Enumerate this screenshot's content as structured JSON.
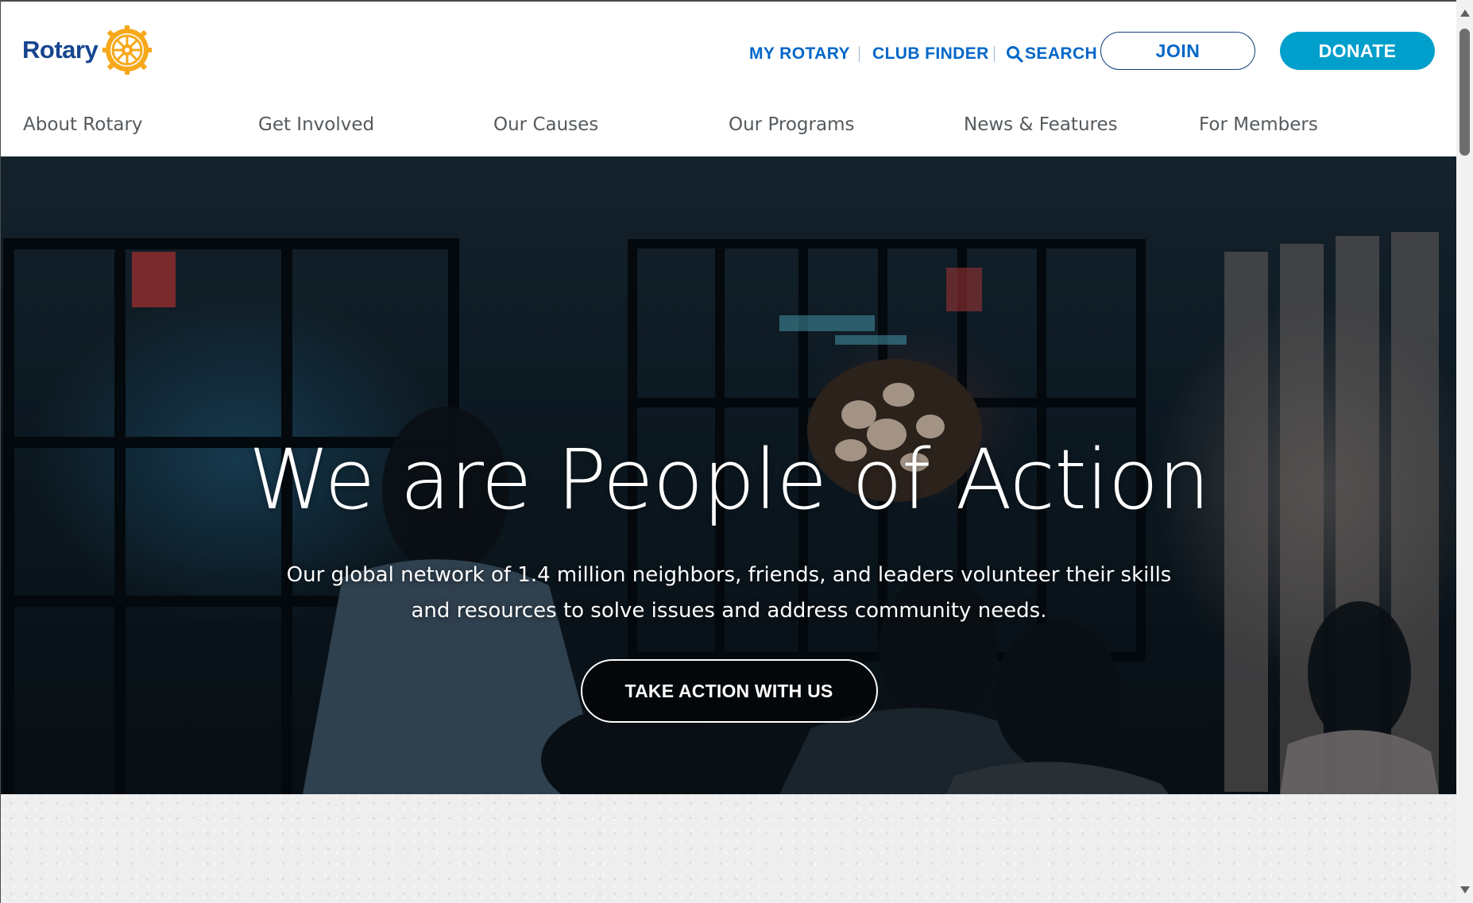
{
  "brand": {
    "name": "Rotary",
    "colors": {
      "navy": "#17458f",
      "link": "#0067c8",
      "donate": "#019fcb",
      "gold": "#f7a81b"
    },
    "logo_icon": "rotary-wheel-icon"
  },
  "utility_nav": {
    "my_rotary": "MY ROTARY",
    "club_finder": "CLUB FINDER",
    "search": "SEARCH",
    "search_icon": "search-icon",
    "join": "JOIN",
    "donate": "DONATE"
  },
  "main_nav": {
    "items": [
      {
        "label": "About Rotary"
      },
      {
        "label": "Get Involved"
      },
      {
        "label": "Our Causes"
      },
      {
        "label": "Our Programs"
      },
      {
        "label": "News & Features"
      },
      {
        "label": "For Members"
      }
    ]
  },
  "hero": {
    "title": "We are People of Action",
    "subtitle": "Our global network of 1.4 million neighbors, friends, and leaders volunteer their skills and resources to solve issues and address community needs.",
    "cta": "TAKE ACTION WITH US"
  }
}
